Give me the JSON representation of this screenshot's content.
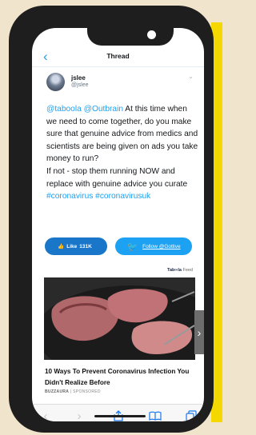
{
  "nav": {
    "title": "Thread"
  },
  "tweet": {
    "name": "jslee",
    "handle": "@jslee",
    "mention1": "@taboola",
    "mention2": "@Outbrain",
    "body1": " At this time when we need to come together, do you make sure that genuine advice from medics and scientists are being given on ads you take money to run?",
    "body2": "If not - stop them running NOW and replace with genuine advice you curate",
    "hashtag1": "#coronavirus",
    "hashtag2": "#coronavirusuk"
  },
  "actions": {
    "like_label": "Like",
    "like_count": "131K",
    "follow_label": "Follow @Gotlive"
  },
  "ad": {
    "provider_a": "Tab",
    "provider_b": "la",
    "feed": "Feed",
    "headline": "10 Ways To Prevent Coronavirus Infection You Didn't Realize Before",
    "source": "BUZZAURA",
    "sponsored": "SPONSORED"
  },
  "icons": {
    "back": "chevron-left-icon",
    "thumb": "thumbs-up-icon",
    "bird": "twitter-bird-icon",
    "next": "chevron-right-icon",
    "share": "share-icon",
    "bookmarks": "book-icon",
    "tabs": "tabs-icon"
  },
  "colors": {
    "link": "#1da1f2",
    "like_button": "#1976c9",
    "follow_button": "#1da1f2",
    "accent_band": "#f4d800"
  }
}
